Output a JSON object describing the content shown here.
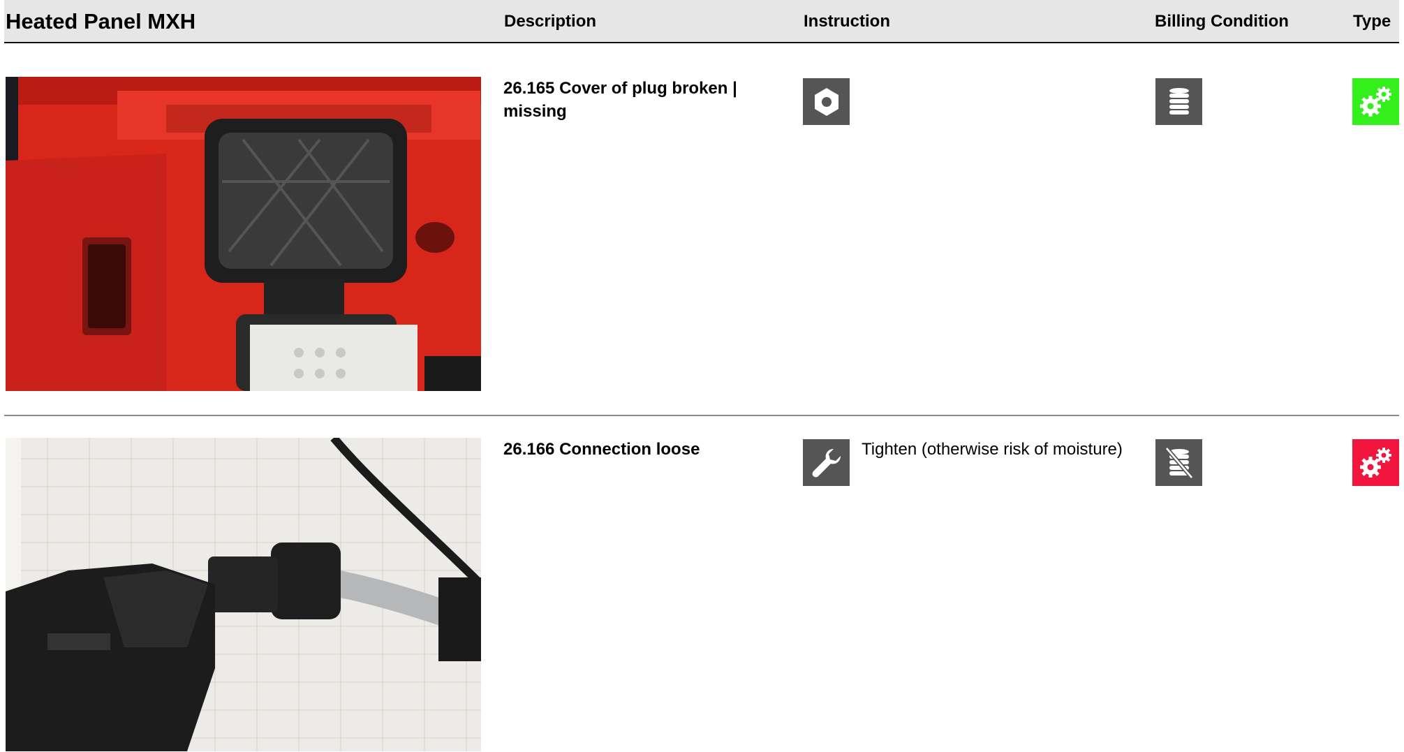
{
  "header": {
    "title": "Heated Panel MXH",
    "columns": {
      "description": "Description",
      "instruction": "Instruction",
      "billing": "Billing Condition",
      "type": "Type"
    }
  },
  "rows": [
    {
      "photo": "photo of open red heated panel with plug cover",
      "description": "26.165 Cover of plug broken | missing",
      "instruction_icon": "hex-nut-icon",
      "instruction_text": "",
      "billing_icon": "coin-stack-icon",
      "type_icon": "gears-icon",
      "type_color": "#33f01c"
    },
    {
      "photo": "photo of black connector with cable on grid paper",
      "description": "26.166 Connection loose",
      "instruction_icon": "wrench-icon",
      "instruction_text": "Tighten (otherwise risk of moisture)",
      "billing_icon": "coin-stack-crossed-icon",
      "type_icon": "gears-icon",
      "type_color": "#f2163f"
    }
  ]
}
